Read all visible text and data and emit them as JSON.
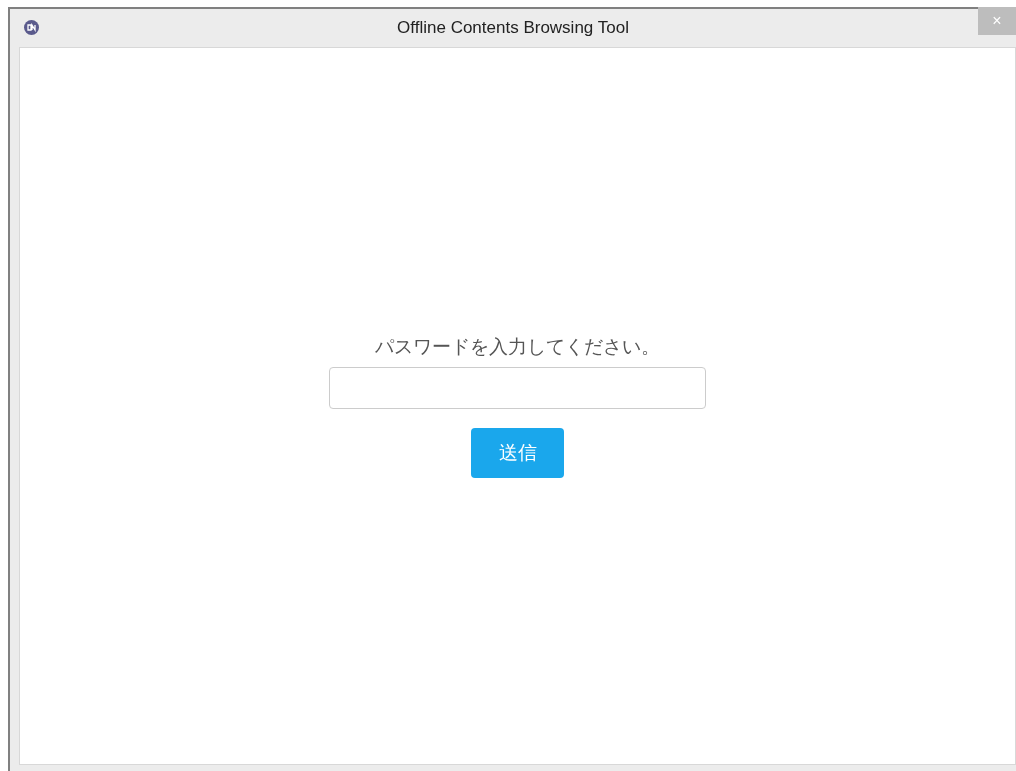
{
  "window": {
    "title": "Offline Contents Browsing Tool",
    "close": "×"
  },
  "form": {
    "prompt": "パスワードを入力してください。",
    "submit": "送信"
  }
}
